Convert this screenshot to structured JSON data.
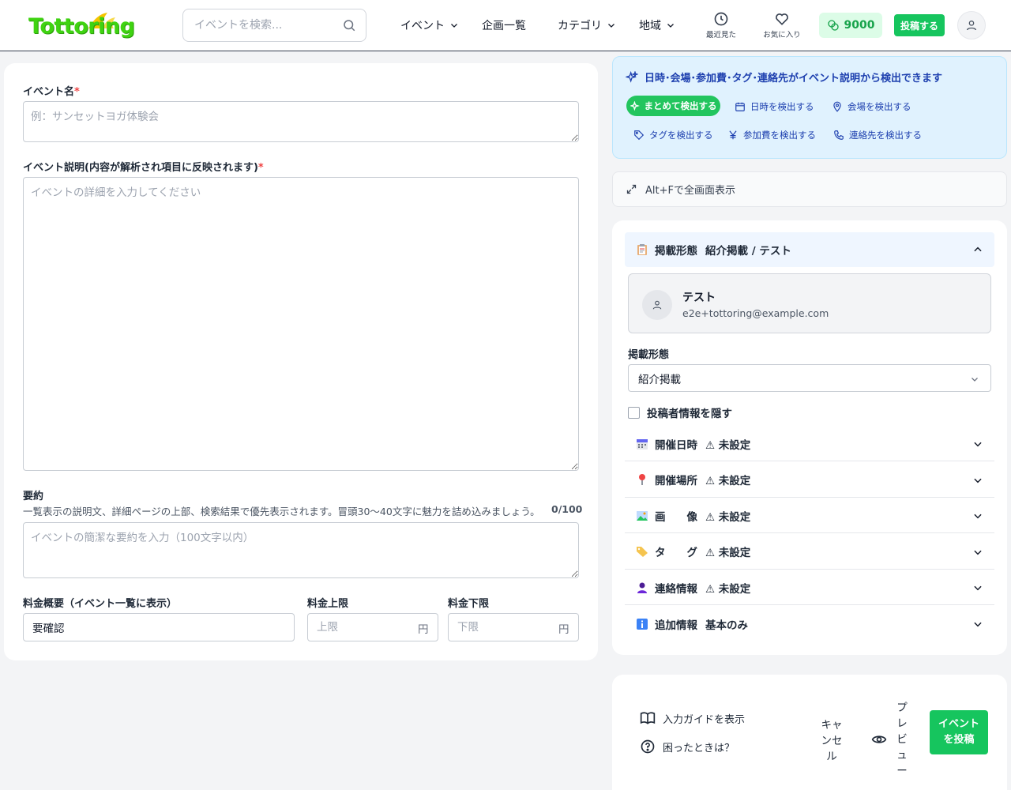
{
  "header": {
    "logo_text": "Tottoring",
    "search_placeholder": "イベントを検索...",
    "nav": {
      "events": "イベント",
      "plans": "企画一覧",
      "category": "カテゴリ",
      "region": "地域",
      "recent": "最近見た",
      "favorites": "お気に入り"
    },
    "points": "9000",
    "post_button": "投稿する"
  },
  "form": {
    "event_name_label": "イベント名",
    "event_name_placeholder": "例：サンセットヨガ体験会",
    "description_label": "イベント説明(内容が解析され項目に反映されます)",
    "description_placeholder": "イベントの詳細を入力してください",
    "summary_label": "要約",
    "summary_hint": "一覧表示の説明文、詳細ページの上部、検索結果で優先表示されます。冒頭30〜40文字に魅力を詰め込みましょう。",
    "summary_counter": "0/100",
    "summary_placeholder": "イベントの簡潔な要約を入力（100文字以内）",
    "fee_overview_label": "料金概要（イベント一覧に表示）",
    "fee_overview_value": "要確認",
    "fee_max_label": "料金上限",
    "fee_max_placeholder": "上限",
    "fee_min_label": "料金下限",
    "fee_min_placeholder": "下限",
    "currency_unit": "円",
    "required_mark": "*"
  },
  "detect": {
    "title": "日時･会場･参加費･タグ･連絡先がイベント説明から検出できます",
    "all": "まとめて検出する",
    "date": "日時を検出する",
    "venue": "会場を検出する",
    "tags": "タグを検出する",
    "fee": "参加費を検出する",
    "contact": "連絡先を検出する"
  },
  "fullscreen_hint": "Alt+Fで全画面表示",
  "settings": {
    "listing": {
      "title": "掲載形態",
      "status": "紹介掲載 / テスト"
    },
    "user": {
      "name": "テスト",
      "email": "e2e+tottoring@example.com"
    },
    "listing_type_label": "掲載形態",
    "listing_type_value": "紹介掲載",
    "hide_poster_label": "投稿者情報を隠す",
    "sections": [
      {
        "title": "開催日時",
        "status": "⚠ 未設定",
        "icon": "calendar-icon"
      },
      {
        "title": "開催場所",
        "status": "⚠ 未設定",
        "icon": "pin-icon"
      },
      {
        "title": "画　　像",
        "status": "⚠ 未設定",
        "icon": "image-icon"
      },
      {
        "title": "タ　　グ",
        "status": "⚠ 未設定",
        "icon": "tag-icon"
      },
      {
        "title": "連絡情報",
        "status": "⚠ 未設定",
        "icon": "person-icon"
      },
      {
        "title": "追加情報",
        "status": "基本のみ",
        "icon": "info-icon"
      }
    ]
  },
  "actions": {
    "guide": "入力ガイドを表示",
    "help": "困ったときは？",
    "cancel": "キャンセル",
    "preview": "プレビュー",
    "submit": "イベントを投稿"
  },
  "colors": {
    "brand_green": "#16c55e",
    "logo_green": "#3fd311",
    "detect_blue": "#1e40af",
    "detect_bg": "#e0f2fe"
  }
}
